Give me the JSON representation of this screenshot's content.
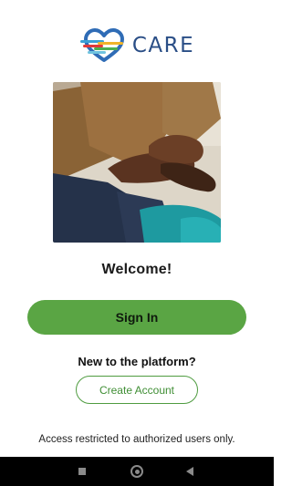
{
  "brand": {
    "name": "CARE",
    "logo_icon": "heart-logo-icon"
  },
  "hero": {
    "image_icon": "clasped-hands-photo"
  },
  "welcome": {
    "title": "Welcome!"
  },
  "actions": {
    "sign_in_label": "Sign In",
    "new_prompt": "New to the platform?",
    "create_account_label": "Create Account"
  },
  "footer": {
    "notice": "Access restricted to authorized users only."
  },
  "system_nav": {
    "recents_icon": "square-icon",
    "home_icon": "circle-home-icon",
    "back_icon": "triangle-back-icon"
  },
  "colors": {
    "primary_green": "#5aa544",
    "brand_blue": "#2a4e86",
    "nav_bar": "#000000"
  }
}
